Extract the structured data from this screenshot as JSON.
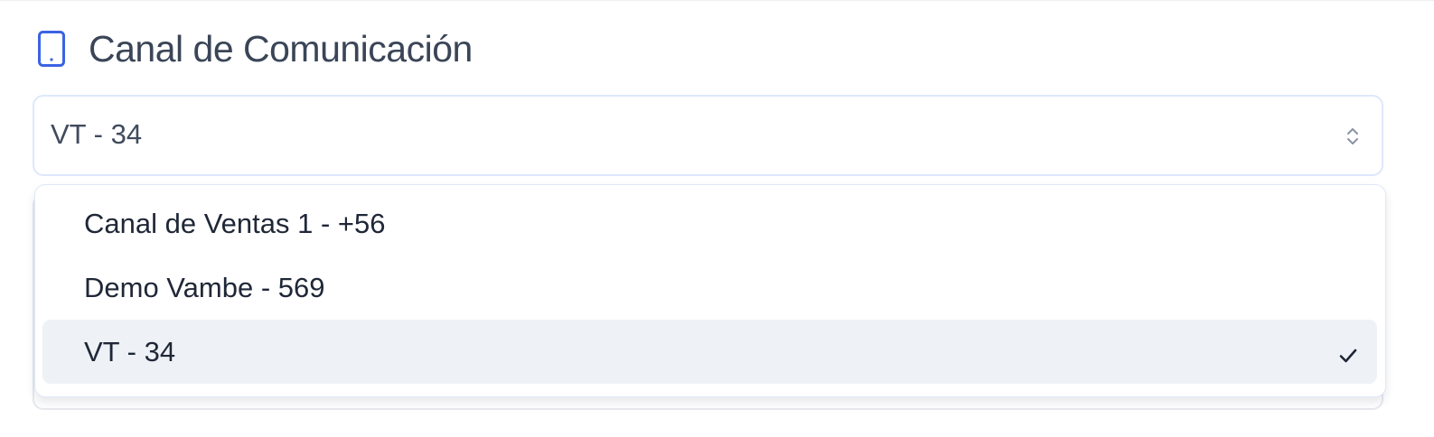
{
  "header": {
    "title": "Canal de Comunicación",
    "icon": "phone-icon",
    "icon_color": "#3b63e3"
  },
  "select": {
    "value": "VT - 34",
    "icon": "chevron-up-down-icon",
    "expanded": true
  },
  "dropdown": {
    "options": [
      {
        "label": "Canal de Ventas 1 - +56",
        "selected": false
      },
      {
        "label": "Demo Vambe - 569",
        "selected": false
      },
      {
        "label": "VT - 34",
        "selected": true
      }
    ],
    "selected_icon": "check-icon",
    "selected_background": "#eef2f7"
  }
}
